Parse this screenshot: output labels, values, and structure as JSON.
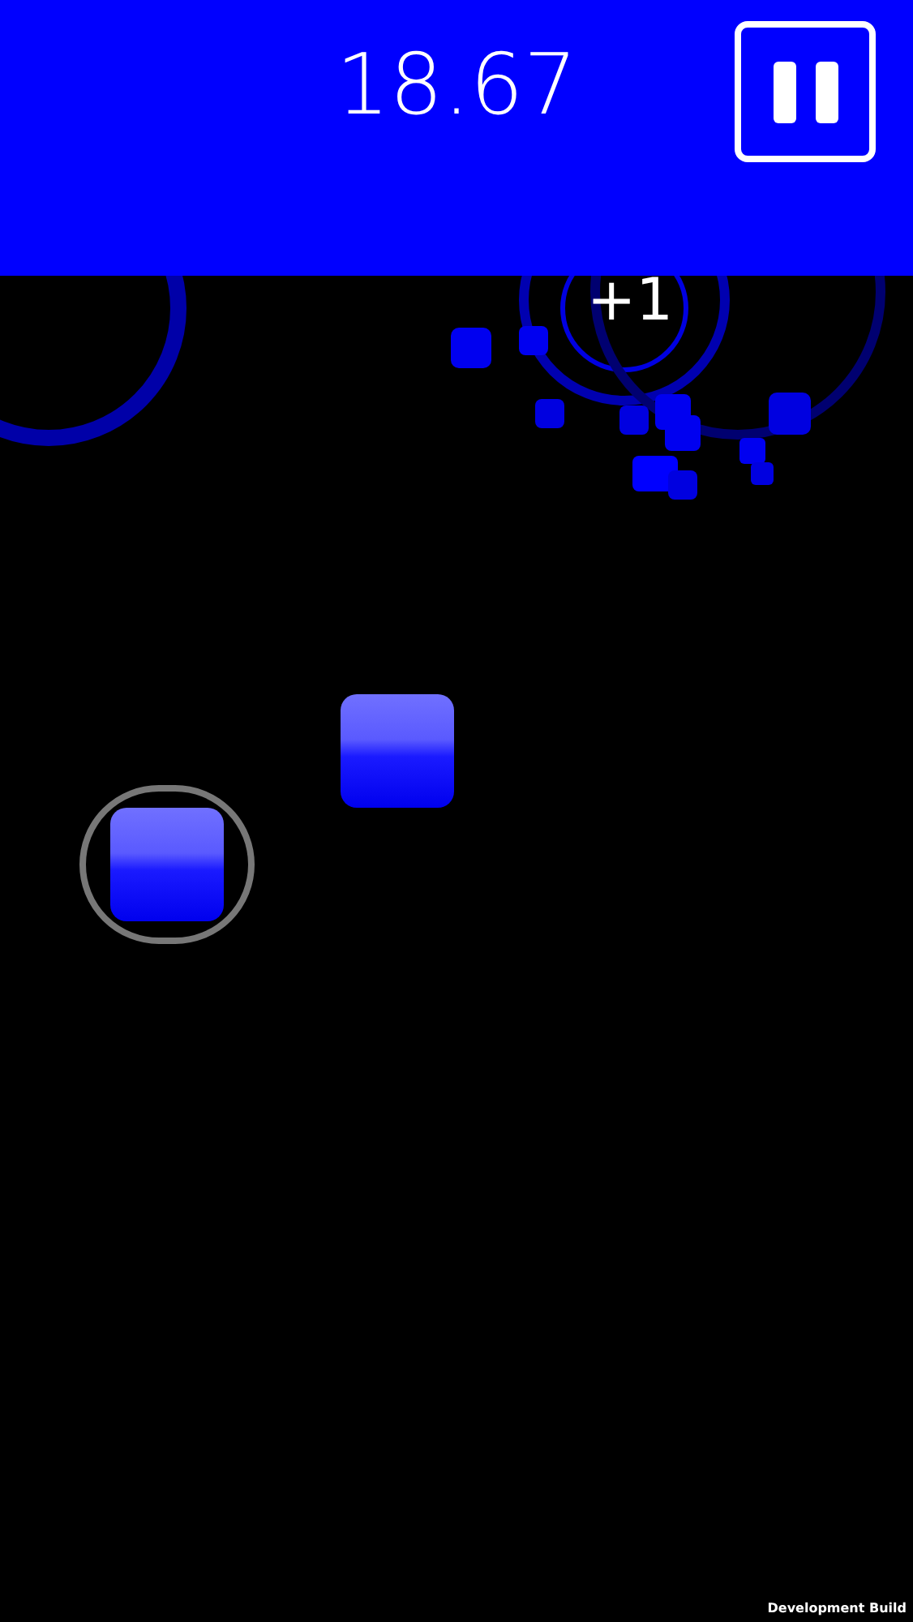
{
  "header": {
    "timer": "18.67"
  },
  "score_popup": "+1",
  "tiles": [
    {
      "selected": false
    },
    {
      "selected": true
    }
  ],
  "build_label": "Development Build"
}
